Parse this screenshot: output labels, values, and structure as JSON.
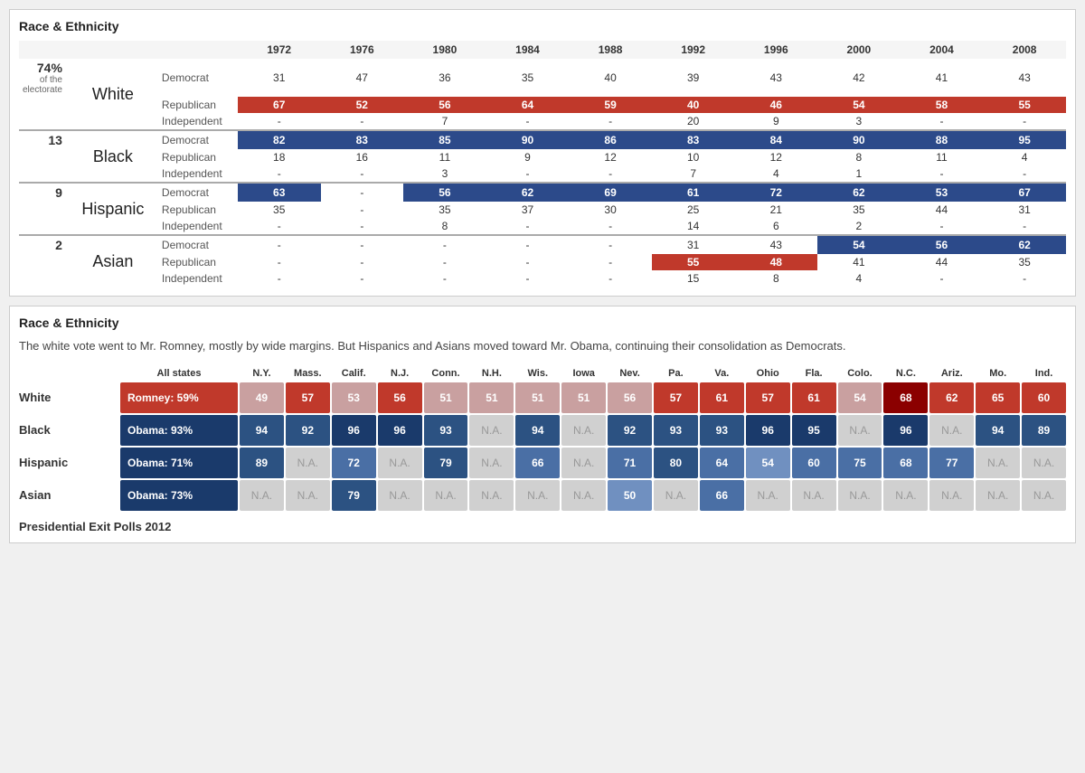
{
  "topPanel": {
    "title": "Race & Ethnicity",
    "years": [
      "1972",
      "1976",
      "1980",
      "1984",
      "1988",
      "1992",
      "1996",
      "2000",
      "2004",
      "2008"
    ],
    "groups": [
      {
        "pct": "74%",
        "subLabel": "of the\nelectorate",
        "name": "White",
        "rows": [
          {
            "party": "Democrat",
            "values": [
              "31",
              "47",
              "36",
              "35",
              "40",
              "39",
              "43",
              "42",
              "41",
              "43"
            ],
            "highlight": []
          },
          {
            "party": "Republican",
            "values": [
              "67",
              "52",
              "56",
              "64",
              "59",
              "40",
              "46",
              "54",
              "58",
              "55"
            ],
            "highlight": [
              0,
              1,
              2,
              3,
              4,
              5,
              6,
              7,
              8,
              9
            ],
            "color": "red"
          },
          {
            "party": "Independent",
            "values": [
              "-",
              "-",
              "7",
              "-",
              "-",
              "20",
              "9",
              "3",
              "-",
              "-"
            ],
            "highlight": []
          }
        ]
      },
      {
        "pct": "13",
        "subLabel": "",
        "name": "Black",
        "rows": [
          {
            "party": "Democrat",
            "values": [
              "82",
              "83",
              "85",
              "90",
              "86",
              "83",
              "84",
              "90",
              "88",
              "95"
            ],
            "highlight": [
              0,
              1,
              2,
              3,
              4,
              5,
              6,
              7,
              8,
              9
            ],
            "color": "blue"
          },
          {
            "party": "Republican",
            "values": [
              "18",
              "16",
              "11",
              "9",
              "12",
              "10",
              "12",
              "8",
              "11",
              "4"
            ],
            "highlight": []
          },
          {
            "party": "Independent",
            "values": [
              "-",
              "-",
              "3",
              "-",
              "-",
              "7",
              "4",
              "1",
              "-",
              "-"
            ],
            "highlight": []
          }
        ]
      },
      {
        "pct": "9",
        "subLabel": "",
        "name": "Hispanic",
        "rows": [
          {
            "party": "Democrat",
            "values": [
              "63",
              "-",
              "56",
              "62",
              "69",
              "61",
              "72",
              "62",
              "53",
              "67"
            ],
            "highlight": [
              0,
              2,
              3,
              4,
              5,
              6,
              7,
              8,
              9
            ],
            "color": "blue"
          },
          {
            "party": "Republican",
            "values": [
              "35",
              "-",
              "35",
              "37",
              "30",
              "25",
              "21",
              "35",
              "44",
              "31"
            ],
            "highlight": []
          },
          {
            "party": "Independent",
            "values": [
              "-",
              "-",
              "8",
              "-",
              "-",
              "14",
              "6",
              "2",
              "-",
              "-"
            ],
            "highlight": []
          }
        ]
      },
      {
        "pct": "2",
        "subLabel": "",
        "name": "Asian",
        "rows": [
          {
            "party": "Democrat",
            "values": [
              "-",
              "-",
              "-",
              "-",
              "-",
              "31",
              "43",
              "54",
              "56",
              "62"
            ],
            "highlight": [
              7,
              8,
              9
            ],
            "color": "blue"
          },
          {
            "party": "Republican",
            "values": [
              "-",
              "-",
              "-",
              "-",
              "-",
              "55",
              "48",
              "41",
              "44",
              "35"
            ],
            "highlight": [
              5,
              6
            ],
            "color": "red"
          },
          {
            "party": "Independent",
            "values": [
              "-",
              "-",
              "-",
              "-",
              "-",
              "15",
              "8",
              "4",
              "-",
              "-"
            ],
            "highlight": []
          }
        ]
      }
    ]
  },
  "bottomPanel": {
    "title": "Race & Ethnicity",
    "description": "The white vote went to Mr. Romney, mostly by wide margins. But Hispanics and Asians moved toward Mr. Obama,\ncontinuing their consolidation as Democrats.",
    "columns": [
      "All states",
      "N.Y.",
      "Mass.",
      "Calif.",
      "N.J.",
      "Conn.",
      "N.H.",
      "Wis.",
      "Iowa",
      "Nev.",
      "Pa.",
      "Va.",
      "Ohio",
      "Fla.",
      "Colo.",
      "N.C.",
      "Ariz.",
      "Mo.",
      "Ind."
    ],
    "rows": [
      {
        "label": "White",
        "summary": "Romney: 59%",
        "summaryColor": "#c0392b",
        "values": [
          "49",
          "57",
          "53",
          "56",
          "51",
          "51",
          "51",
          "51",
          "56",
          "57",
          "61",
          "57",
          "61",
          "54",
          "68",
          "62",
          "65",
          "60"
        ],
        "colors": [
          "r1",
          "r2",
          "r1",
          "r2",
          "r1",
          "r1",
          "r1",
          "r1",
          "r1",
          "r2",
          "r2",
          "r2",
          "r2",
          "r1",
          "r3",
          "r2",
          "r2",
          "r2"
        ]
      },
      {
        "label": "Black",
        "summary": "Obama: 93%",
        "summaryColor": "#1a3a6b",
        "values": [
          "94",
          "92",
          "96",
          "96",
          "93",
          "N.A.",
          "94",
          "N.A.",
          "92",
          "93",
          "93",
          "96",
          "95",
          "N.A.",
          "96",
          "N.A.",
          "94",
          "89"
        ],
        "colors": [
          "b3",
          "b3",
          "b4",
          "b4",
          "b3",
          "na",
          "b3",
          "na",
          "b3",
          "b3",
          "b3",
          "b4",
          "b4",
          "na",
          "b4",
          "na",
          "b3",
          "b3"
        ]
      },
      {
        "label": "Hispanic",
        "summary": "Obama: 71%",
        "summaryColor": "#1a3a6b",
        "values": [
          "89",
          "N.A.",
          "72",
          "N.A.",
          "79",
          "N.A.",
          "66",
          "N.A.",
          "71",
          "80",
          "64",
          "54",
          "60",
          "75",
          "68",
          "77",
          "N.A.",
          "N.A."
        ],
        "colors": [
          "b3",
          "na",
          "b2",
          "na",
          "b3",
          "na",
          "b2",
          "na",
          "b2",
          "b3",
          "b2",
          "b1",
          "b2",
          "b2",
          "b2",
          "b2",
          "na",
          "na"
        ]
      },
      {
        "label": "Asian",
        "summary": "Obama: 73%",
        "summaryColor": "#1a3a6b",
        "values": [
          "N.A.",
          "N.A.",
          "79",
          "N.A.",
          "N.A.",
          "N.A.",
          "N.A.",
          "N.A.",
          "50",
          "N.A.",
          "66",
          "N.A.",
          "N.A.",
          "N.A.",
          "N.A.",
          "N.A.",
          "N.A.",
          "N.A."
        ],
        "colors": [
          "na",
          "na",
          "b3",
          "na",
          "na",
          "na",
          "na",
          "na",
          "b1",
          "na",
          "b2",
          "na",
          "na",
          "na",
          "na",
          "na",
          "na",
          "na"
        ]
      }
    ],
    "footnote": "Presidential Exit Polls 2012"
  },
  "colorMap": {
    "r1": "#c9a0a0",
    "r2": "#c0392b",
    "r3": "#8b0000",
    "b1": "#7090c0",
    "b2": "#4a6fa5",
    "b3": "#2c5282",
    "b4": "#1a3a6b",
    "na": "#d0d0d0"
  }
}
